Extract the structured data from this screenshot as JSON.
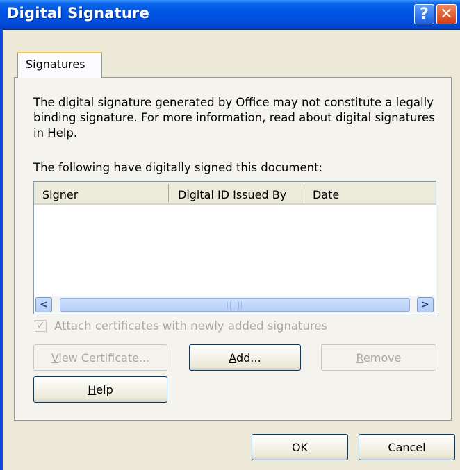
{
  "window": {
    "title": "Digital Signature",
    "title_buttons": {
      "help_label": "?",
      "close_label": "✕"
    }
  },
  "tabs": [
    {
      "label": "Signatures"
    }
  ],
  "description": "The digital signature generated by Office may not constitute a legally binding signature. For more information, read about digital signatures in Help.",
  "list_label": "The following have digitally signed this document:",
  "table": {
    "columns": [
      "Signer",
      "Digital ID Issued By",
      "Date"
    ],
    "rows": []
  },
  "scrollbar": {
    "left_arrow": "<",
    "right_arrow": ">"
  },
  "attach_checkbox": {
    "label": "Attach certificates with newly added signatures",
    "checked": true,
    "enabled": false,
    "checkmark": "✓"
  },
  "buttons": {
    "view_certificate": "View Certificate...",
    "add": "Add...",
    "remove": "Remove",
    "help": "Help",
    "ok": "OK",
    "cancel": "Cancel"
  },
  "colors": {
    "titlebar": "#0050dd",
    "dialog_bg": "#ece9d8",
    "tab_highlight": "#ffc83c"
  }
}
